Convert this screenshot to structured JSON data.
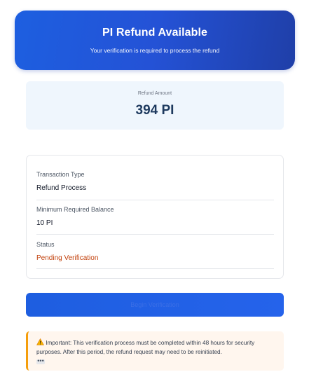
{
  "header": {
    "title": "PI Refund Available",
    "subtitle": "Your verification is required to process the refund"
  },
  "amount": {
    "label": "Refund Amount",
    "value": "394 PI"
  },
  "details": {
    "rows": [
      {
        "label": "Transaction Type",
        "value": "Refund Process"
      },
      {
        "label": "Minimum Required Balance",
        "value": "10 PI"
      },
      {
        "label": "Status",
        "value": "Pending Verification"
      }
    ]
  },
  "button": {
    "label": "Begin Verification"
  },
  "notice": {
    "text": "Important: This verification process must be completed within 48 hours for security purposes. After this period, the refund request may need to be reinitiated.",
    "icon": "warning-icon",
    "more_icon": "more-icon"
  },
  "colors": {
    "header_bg": "#1d5fe0",
    "amount_value": "#1e3a5f",
    "pending_status": "#c2410c",
    "notice_border": "#f59e0b",
    "notice_bg": "#fff6ee"
  }
}
